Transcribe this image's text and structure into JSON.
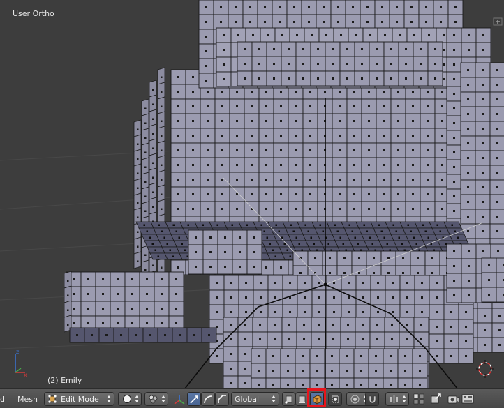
{
  "viewport": {
    "view_name": "User Ortho",
    "object_name": "(2) Emily"
  },
  "header": {
    "menu_edge_label": "d",
    "menu_mesh_label": "Mesh",
    "mode_selector": "Edit Mode",
    "orientation_selector": "Global"
  },
  "colors": {
    "cube_face": "#9b9bb0",
    "cube_top": "#b4b4c8",
    "cube_dark": "#55566e",
    "edge": "#1a1a1a",
    "header_bg": "#4f4f4f",
    "highlight": "#e8141b",
    "active_icon": "#e09a3a"
  },
  "icons": {
    "mode_icon": "edit-mode-icon",
    "shading_icon": "solid-sphere-icon",
    "pivot_icon": "pivot-point-icon",
    "manipulator_icon": "manipulator-axes-icon",
    "translate_icon": "translate-arrow-icon",
    "rotate_icon": "rotate-arc-icon",
    "scale_icon": "scale-icon",
    "layer_icon": "layer-icon",
    "occlude_icon": "limit-selection-to-visible-icon",
    "proportional_icon": "proportional-edit-icon",
    "snap_icon": "magnet-snap-icon",
    "render_icon": "render-camera-icon"
  }
}
